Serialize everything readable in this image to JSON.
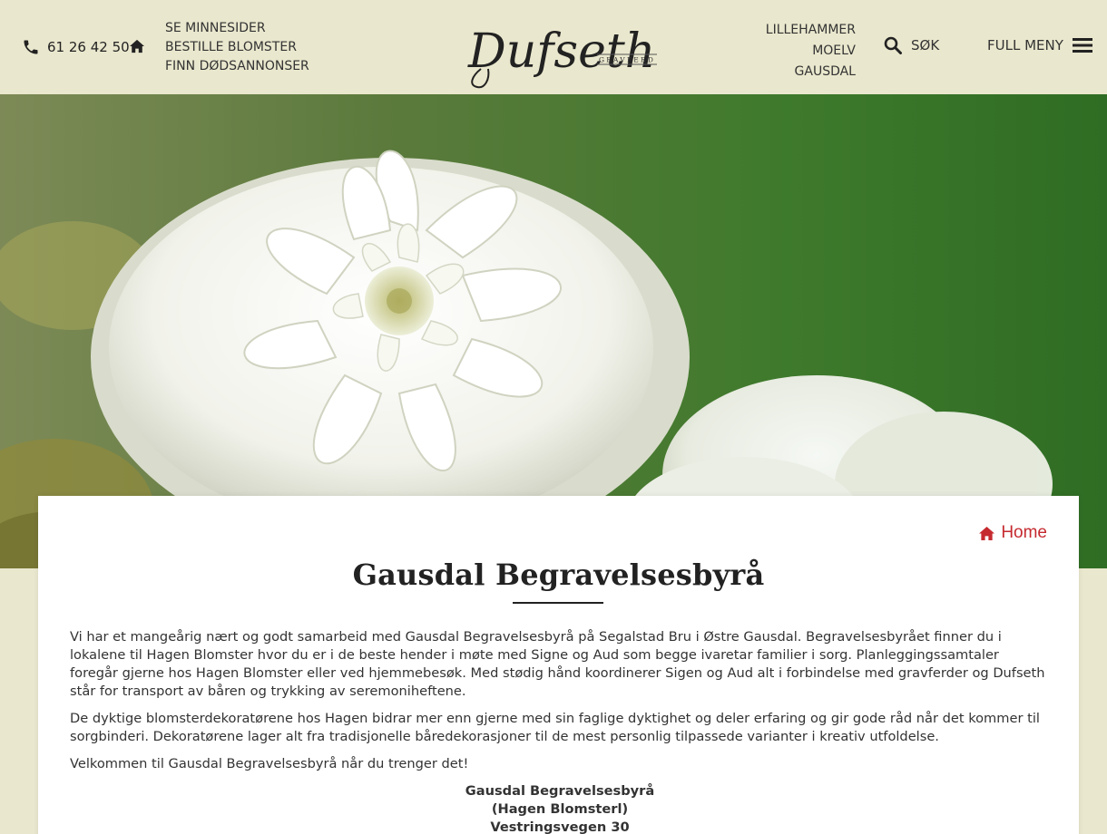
{
  "header": {
    "phone": "61 26 42 50",
    "quick_links": [
      "SE MINNESIDER",
      "BESTILLE BLOMSTER",
      "FINN DØDSANNONSER"
    ],
    "logo_text": "Dufseth",
    "logo_subtitle": "GRAVFERD",
    "locations": [
      "LILLEHAMMER",
      "MOELV",
      "GAUSDAL"
    ],
    "search_label": "SØK",
    "menu_label": "FULL MENY"
  },
  "breadcrumb": {
    "label": "Home"
  },
  "page": {
    "title": "Gausdal Begravelsesbyrå",
    "paragraphs": [
      "Vi har et mangeårig nært og godt samarbeid med Gausdal Begravelsesbyrå på Segalstad Bru i Østre Gausdal. Begravelsesbyrået finner du i lokalene til Hagen Blomster hvor du er i de beste hender i møte med Signe og Aud som begge ivaretar familier i sorg. Planleggingssamtaler foregår gjerne hos Hagen Blomster eller ved hjemmebesøk. Med stødig hånd koordinerer Sigen og Aud alt i forbindelse med gravferder og Dufseth står for transport av båren og trykking av seremoniheftene.",
      "De dyktige blomsterdekoratørene hos Hagen bidrar mer enn gjerne med sin faglige dyktighet og deler erfaring og gir gode råd når det kommer til sorgbinderi. Dekoratørene lager alt fra tradisjonelle båredekorasjoner til de mest personlig tilpassede varianter i kreativ utfoldelse.",
      "Velkommen til Gausdal Begravelsesbyrå når du trenger det!"
    ],
    "address": [
      "Gausdal Begravelsesbyrå",
      "(Hagen Blomsterl)",
      "Vestringsvegen 30"
    ]
  },
  "colors": {
    "header_bg": "#e9e7cd",
    "accent_red": "#c52a2f",
    "text": "#333333"
  }
}
